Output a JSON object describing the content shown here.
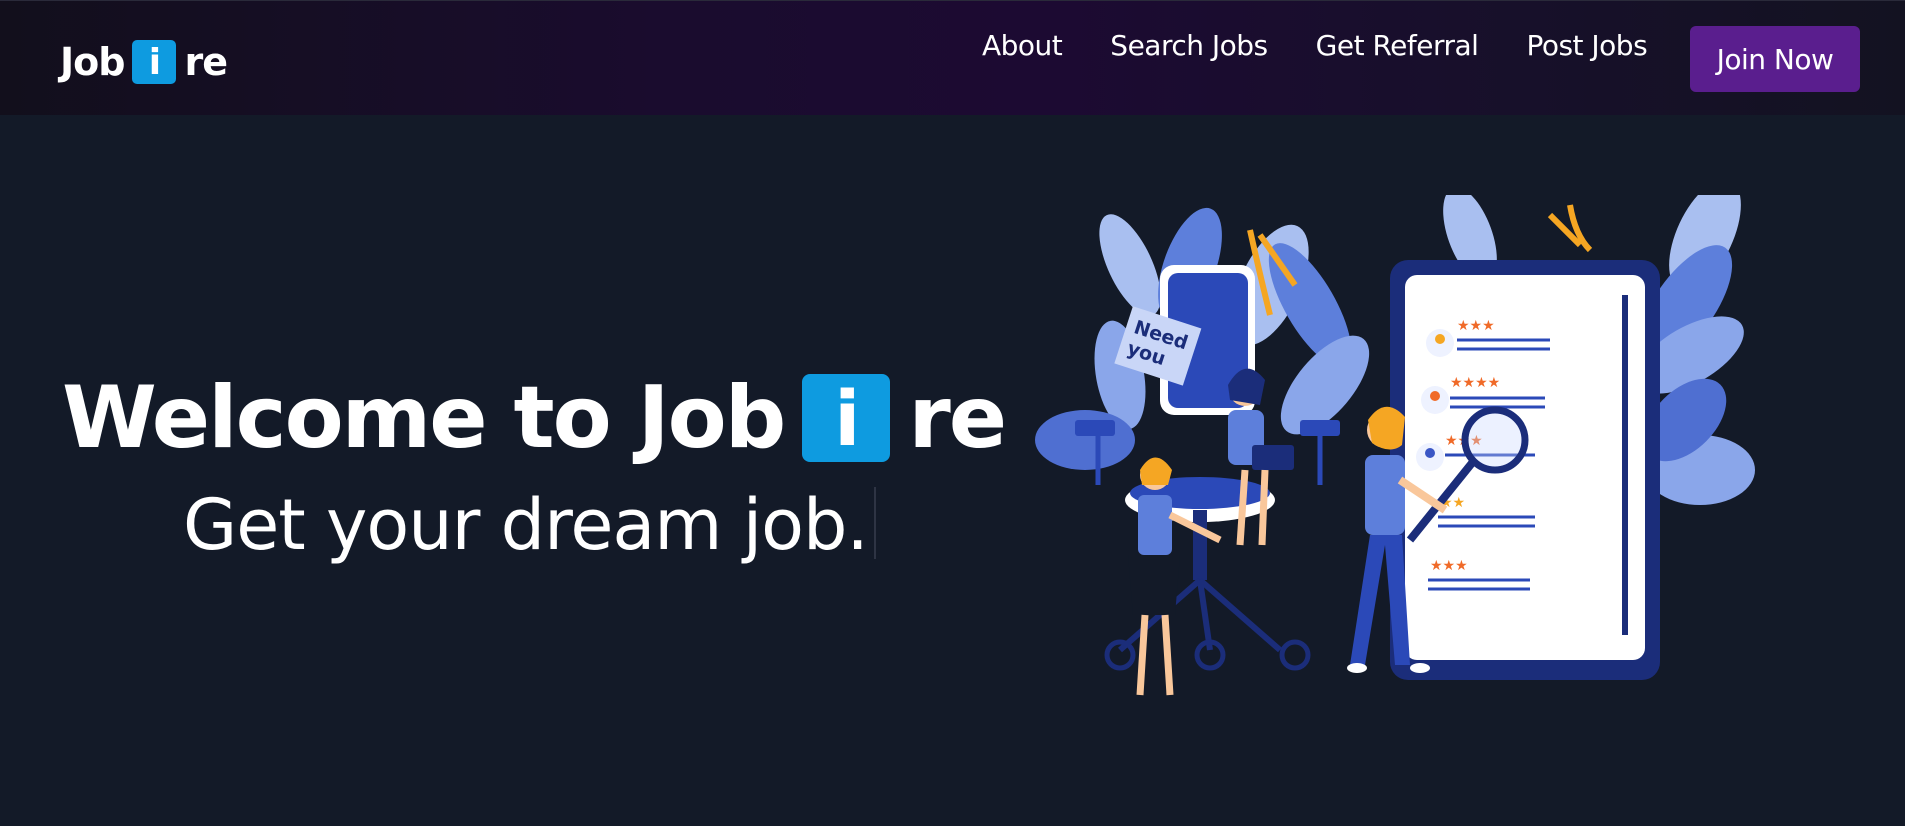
{
  "nav": {
    "logo": {
      "prefix": "Job",
      "i": "i",
      "suffix": "re"
    },
    "links": [
      {
        "label": "About"
      },
      {
        "label": "Search Jobs"
      },
      {
        "label": "Get Referral"
      },
      {
        "label": "Post Jobs"
      }
    ],
    "join_label": "Join Now"
  },
  "hero": {
    "title_prefix": "Welcome to Job",
    "title_i": "i",
    "title_suffix": "re",
    "subtitle": "Get your dream job.",
    "illustration": {
      "sign_line1": "Need",
      "sign_line2": "you"
    }
  },
  "colors": {
    "accent_blue": "#0e9be0",
    "join_button": "#5a1e8e",
    "background": "#131a28"
  }
}
